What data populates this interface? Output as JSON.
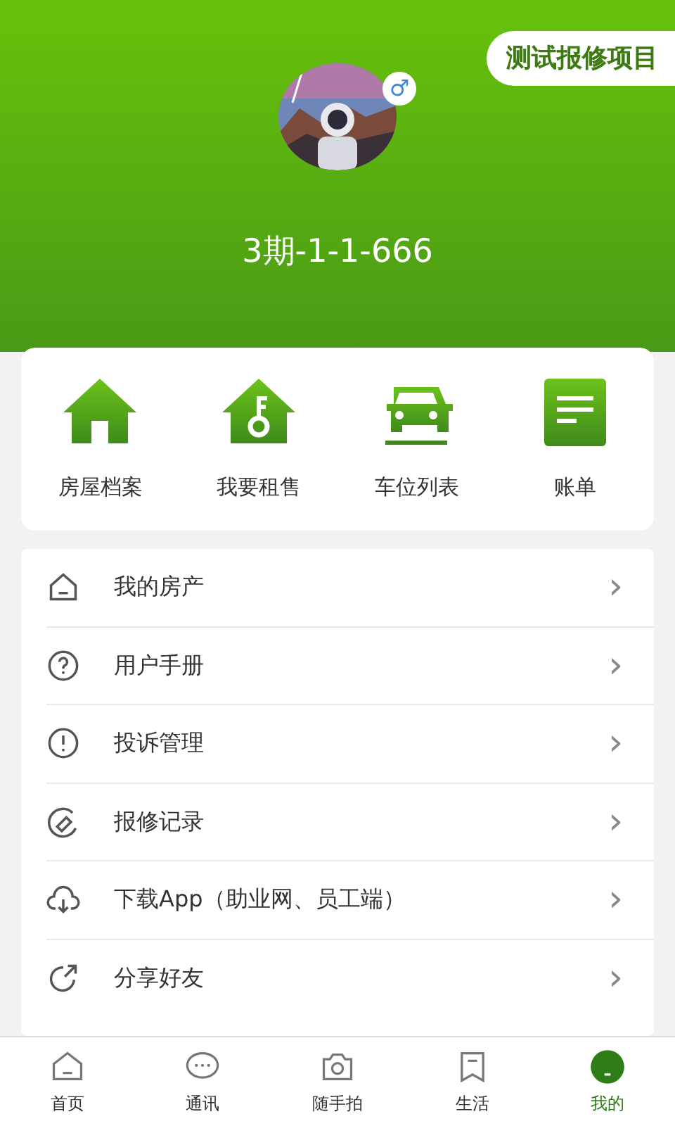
{
  "header": {
    "project_button": "测试报修项目",
    "gender_badge": "♂",
    "room": "3期-1-1-666"
  },
  "shortcuts": [
    {
      "kind": "house",
      "label": "房屋档案"
    },
    {
      "kind": "key-house",
      "label": "我要租售"
    },
    {
      "kind": "car",
      "label": "车位列表"
    },
    {
      "kind": "bill",
      "label": "账单"
    }
  ],
  "menu": [
    {
      "kind": "house",
      "label": "我的房产",
      "arrow": "›"
    },
    {
      "kind": "question",
      "label": "用户手册",
      "arrow": "›"
    },
    {
      "kind": "alert",
      "label": "投诉管理",
      "arrow": "›"
    },
    {
      "kind": "repair",
      "label": "报修记录",
      "arrow": "›"
    },
    {
      "kind": "download",
      "label": "下载App（助业网、员工端）",
      "arrow": "›"
    },
    {
      "kind": "share",
      "label": "分享好友",
      "arrow": "›"
    }
  ],
  "tabs": [
    {
      "kind": "home",
      "label": "首页",
      "selected": false
    },
    {
      "kind": "chat",
      "label": "通讯",
      "selected": false
    },
    {
      "kind": "camera",
      "label": "随手拍",
      "selected": false
    },
    {
      "kind": "bookmark",
      "label": "生活",
      "selected": false
    },
    {
      "kind": "me",
      "label": "我的",
      "selected": true
    }
  ]
}
